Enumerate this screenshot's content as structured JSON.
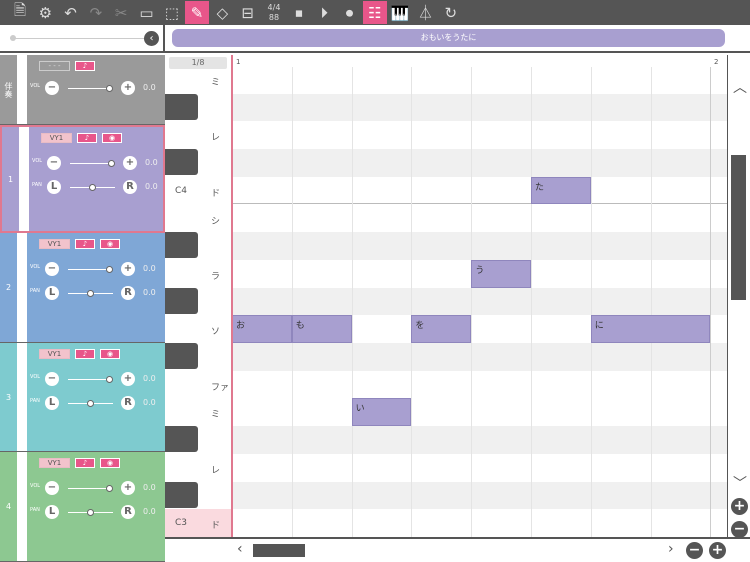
{
  "toolbar": {
    "items": [
      {
        "icon": "file-music-icon",
        "glyph": "🗎"
      },
      {
        "icon": "gear-icon",
        "glyph": "⚙"
      },
      {
        "icon": "undo-icon",
        "glyph": "↶"
      },
      {
        "icon": "redo-icon",
        "glyph": "↷"
      },
      {
        "icon": "scissors-icon",
        "glyph": "✂"
      },
      {
        "icon": "select-icon",
        "glyph": "▭"
      },
      {
        "icon": "marquee-select-icon",
        "glyph": "⬚"
      },
      {
        "icon": "pencil-icon",
        "glyph": "✎"
      },
      {
        "icon": "eraser-icon",
        "glyph": "◇"
      },
      {
        "icon": "toolbox-icon",
        "glyph": "⊟"
      }
    ],
    "time_signature": "4/4",
    "tempo": "88",
    "transport": [
      {
        "icon": "stop-icon",
        "glyph": "⏹"
      },
      {
        "icon": "play-icon",
        "glyph": "⏵"
      },
      {
        "icon": "record-icon",
        "glyph": "⏺"
      },
      {
        "icon": "editor-view-icon",
        "glyph": "☷"
      },
      {
        "icon": "piano-icon",
        "glyph": "🎹"
      },
      {
        "icon": "metronome-icon",
        "glyph": "⏃"
      },
      {
        "icon": "loop-icon",
        "glyph": "↻"
      }
    ]
  },
  "lyric_bar": "おもいをうたに",
  "quantize": "1/8",
  "ruler": [
    "1",
    "2"
  ],
  "tracks": [
    {
      "name": "伴奏",
      "color": "#9a9a9a",
      "vol": "0.0"
    },
    {
      "name": "1",
      "color": "#a89fd0",
      "voice": "VY1",
      "vol": "0.0",
      "pan": "0.0"
    },
    {
      "name": "2",
      "color": "#7fa7d6",
      "voice": "VY1",
      "vol": "0.0",
      "pan": "0.0"
    },
    {
      "name": "3",
      "color": "#7ecbcf",
      "voice": "VY1",
      "vol": "0.0",
      "pan": "0.0"
    },
    {
      "name": "4",
      "color": "#8dc891",
      "voice": "VY1",
      "vol": "0.0",
      "pan": "0.0"
    }
  ],
  "labels": {
    "vol": "VOL",
    "pan": "PAN",
    "L": "L",
    "R": "R",
    "dash": "- - -"
  },
  "keys": [
    "ミ",
    "",
    "レ",
    "",
    "ド",
    "シ",
    "",
    "ラ",
    "",
    "ソ",
    "",
    "ファ",
    "ミ",
    "",
    "レ",
    "",
    "ド"
  ],
  "octaves": {
    "c4": "C4",
    "c3": "C3"
  },
  "notes": [
    {
      "lyric": "お",
      "row": 9,
      "start": 0,
      "len": 1
    },
    {
      "lyric": "も",
      "row": 9,
      "start": 1,
      "len": 1
    },
    {
      "lyric": "い",
      "row": 12,
      "start": 2,
      "len": 1
    },
    {
      "lyric": "を",
      "row": 9,
      "start": 3,
      "len": 1
    },
    {
      "lyric": "う",
      "row": 7,
      "start": 4,
      "len": 1
    },
    {
      "lyric": "た",
      "row": 4,
      "start": 5,
      "len": 1
    },
    {
      "lyric": "に",
      "row": 9,
      "start": 6,
      "len": 2
    }
  ]
}
